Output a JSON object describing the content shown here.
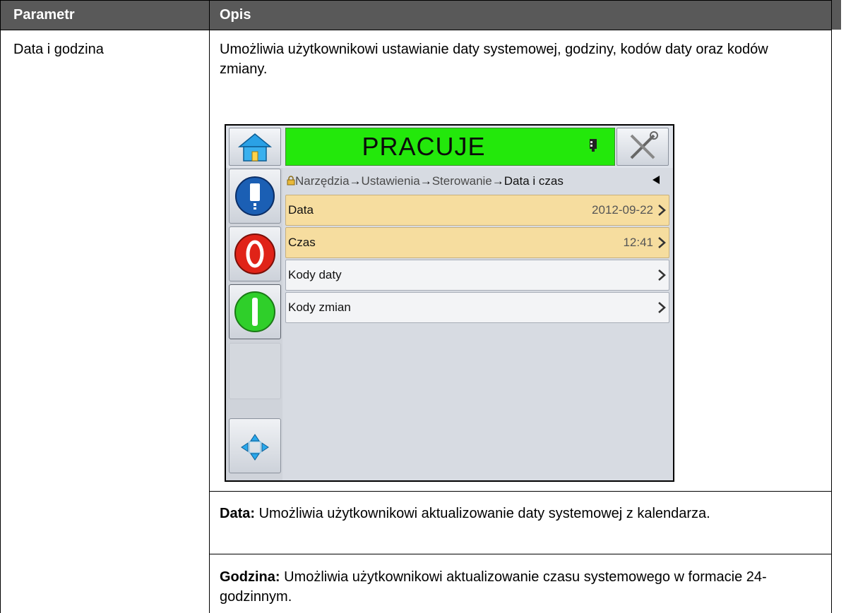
{
  "table": {
    "header_param": "Parametr",
    "header_opis": "Opis",
    "param_name": "Data i godzina",
    "description": "Umożliwia użytkownikowi ustawianie daty systemowej, godziny, kodów daty oraz kodów zmiany.",
    "data_term": "Data:",
    "data_desc": " Umożliwia użytkownikowi aktualizowanie daty systemowej z kalendarza.",
    "godzina_term": "Godzina:",
    "godzina_desc": " Umożliwia użytkownikowi aktualizowanie czasu systemowego w formacie 24-godzinnym."
  },
  "device": {
    "status": "PRACUJE",
    "status_color": "#23e80b",
    "breadcrumb": [
      "Narzędzia",
      "Ustawienia",
      "Sterowanie",
      "Data i czas"
    ],
    "breadcrumb_sep": "→",
    "back_icon": "left-triangle-icon",
    "rows": [
      {
        "label": "Data",
        "value": "2012-09-22",
        "highlight": true
      },
      {
        "label": "Czas",
        "value": "12:41",
        "highlight": true
      },
      {
        "label": "Kody daty",
        "value": "",
        "highlight": false
      },
      {
        "label": "Kody zmian",
        "value": "",
        "highlight": false
      }
    ],
    "highlight_color": "#f6dd9f",
    "icons": [
      "home-icon",
      "tools-icon",
      "ink-cartridge-icon",
      "info-book-icon",
      "stop-icon",
      "start-icon",
      "navigation-icon",
      "lock-icon"
    ]
  }
}
